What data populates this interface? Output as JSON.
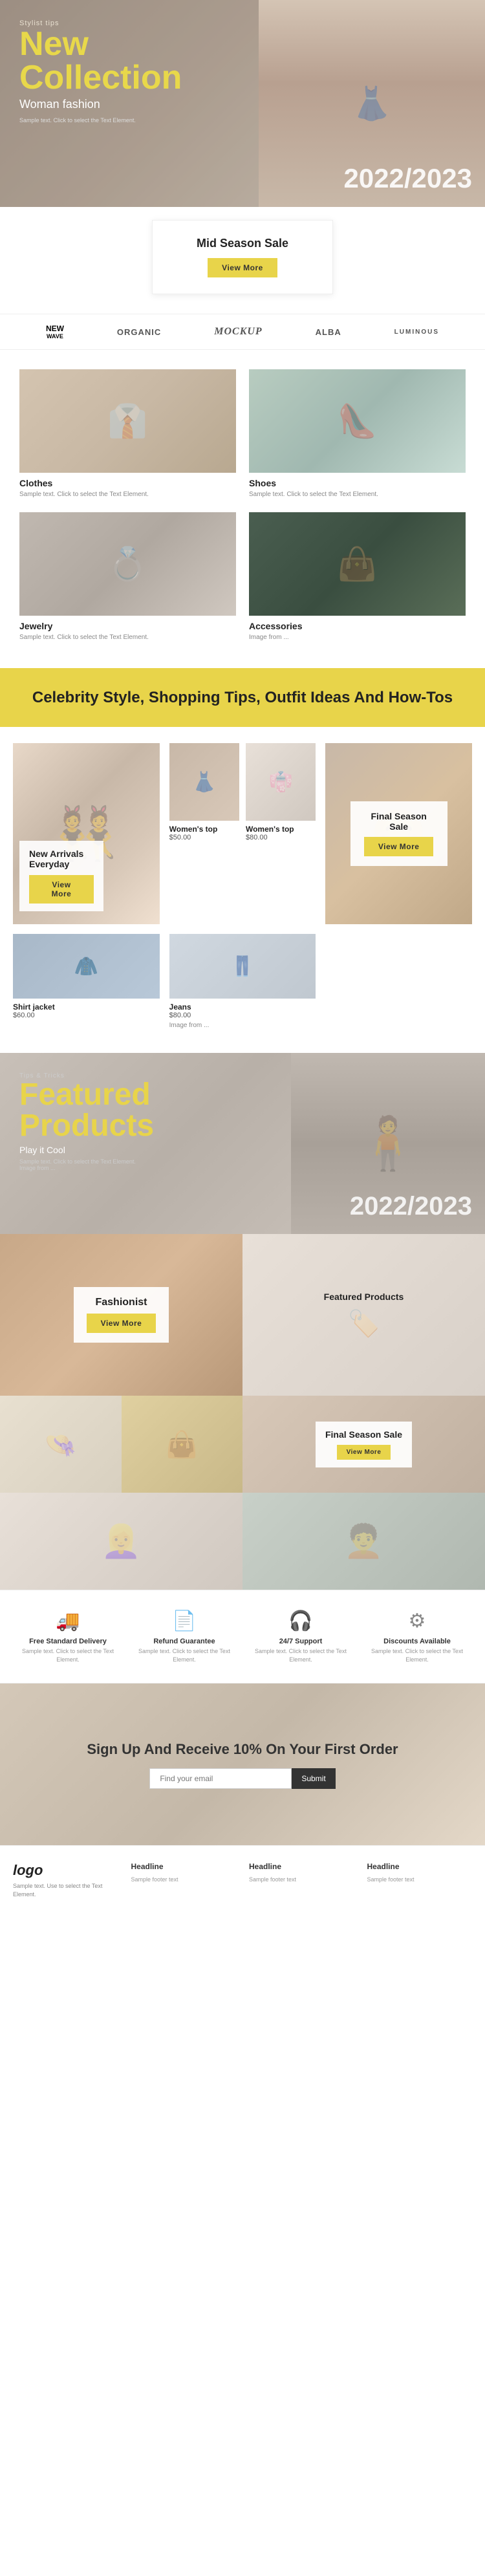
{
  "hero": {
    "stylist_tips": "Stylist tips",
    "title_line1": "New",
    "title_line2": "Collection",
    "subtitle": "Woman fashion",
    "desc": "Sample text. Click to select the Text Element.",
    "year": "2022/2023"
  },
  "sale_card": {
    "title": "Mid Season Sale",
    "button": "View More"
  },
  "brands": [
    {
      "name": "NEW WAVE",
      "type": "stacked"
    },
    {
      "name": "ORGANIC",
      "type": "normal"
    },
    {
      "name": "Mockup",
      "type": "script"
    },
    {
      "name": "Alba",
      "type": "normal"
    },
    {
      "name": "LUMINOUS",
      "type": "normal"
    }
  ],
  "categories": [
    {
      "name": "Clothes",
      "desc": "Sample text. Click to select the Text Element.",
      "type": "clothes"
    },
    {
      "name": "Shoes",
      "desc": "Sample text. Click to select the Text Element.",
      "type": "shoes"
    },
    {
      "name": "Jewelry",
      "desc": "Sample text. Click to select the Text Element.",
      "type": "jewelry"
    },
    {
      "name": "Accessories",
      "desc": "Image from ...",
      "type": "accessories"
    }
  ],
  "yellow_banner": {
    "text": "Celebrity Style, Shopping Tips, Outfit Ideas And How-Tos"
  },
  "new_arrivals": {
    "label": "New Arrivals Everyday",
    "button": "View More"
  },
  "products": [
    {
      "name": "Women's top",
      "price": "$50.00"
    },
    {
      "name": "Women's top",
      "price": "$80.00"
    }
  ],
  "final_season": {
    "label": "Final Season Sale",
    "button": "View More"
  },
  "shirt_jacket": {
    "name": "Shirt jacket",
    "price": "$60.00"
  },
  "jeans": {
    "name": "Jeans",
    "price": "$80.00",
    "note": "Image from ..."
  },
  "featured_hero": {
    "tag": "Tips & Tricks",
    "title_line1": "Featured",
    "title_line2": "Products",
    "subtitle": "Play it Cool",
    "desc": "Sample text. Click to select the Text Element. Image from ...",
    "year": "2022/2023"
  },
  "fashionist": {
    "label": "Fashionist",
    "button": "View More"
  },
  "featured_products_label": "Featured Products",
  "final_season_bottom": {
    "label": "Final Season Sale",
    "button": "View More"
  },
  "icons": [
    {
      "icon": "🚚",
      "title": "Free Standard Delivery",
      "desc": "Sample text. Click to select the Text Element."
    },
    {
      "icon": "📄",
      "title": "Refund Guarantee",
      "desc": "Sample text. Click to select the Text Element."
    },
    {
      "icon": "🎧",
      "title": "24/7 Support",
      "desc": "Sample text. Click to select the Text Element."
    },
    {
      "icon": "⚙",
      "title": "Discounts Available",
      "desc": "Sample text. Click to select the Text Element."
    }
  ],
  "newsletter": {
    "title": "Sign Up And Receive 10% On Your First Order",
    "input_placeholder": "Find your email",
    "button": "Submit"
  },
  "footer": {
    "logo": "logo",
    "tagline": "Sample text. Use to select the Text Element.",
    "columns": [
      {
        "title": "Headline",
        "placeholder": "Sample footer text"
      },
      {
        "title": "Headline",
        "placeholder": "Sample footer text"
      },
      {
        "title": "Headline",
        "placeholder": "Sample footer text"
      }
    ]
  }
}
